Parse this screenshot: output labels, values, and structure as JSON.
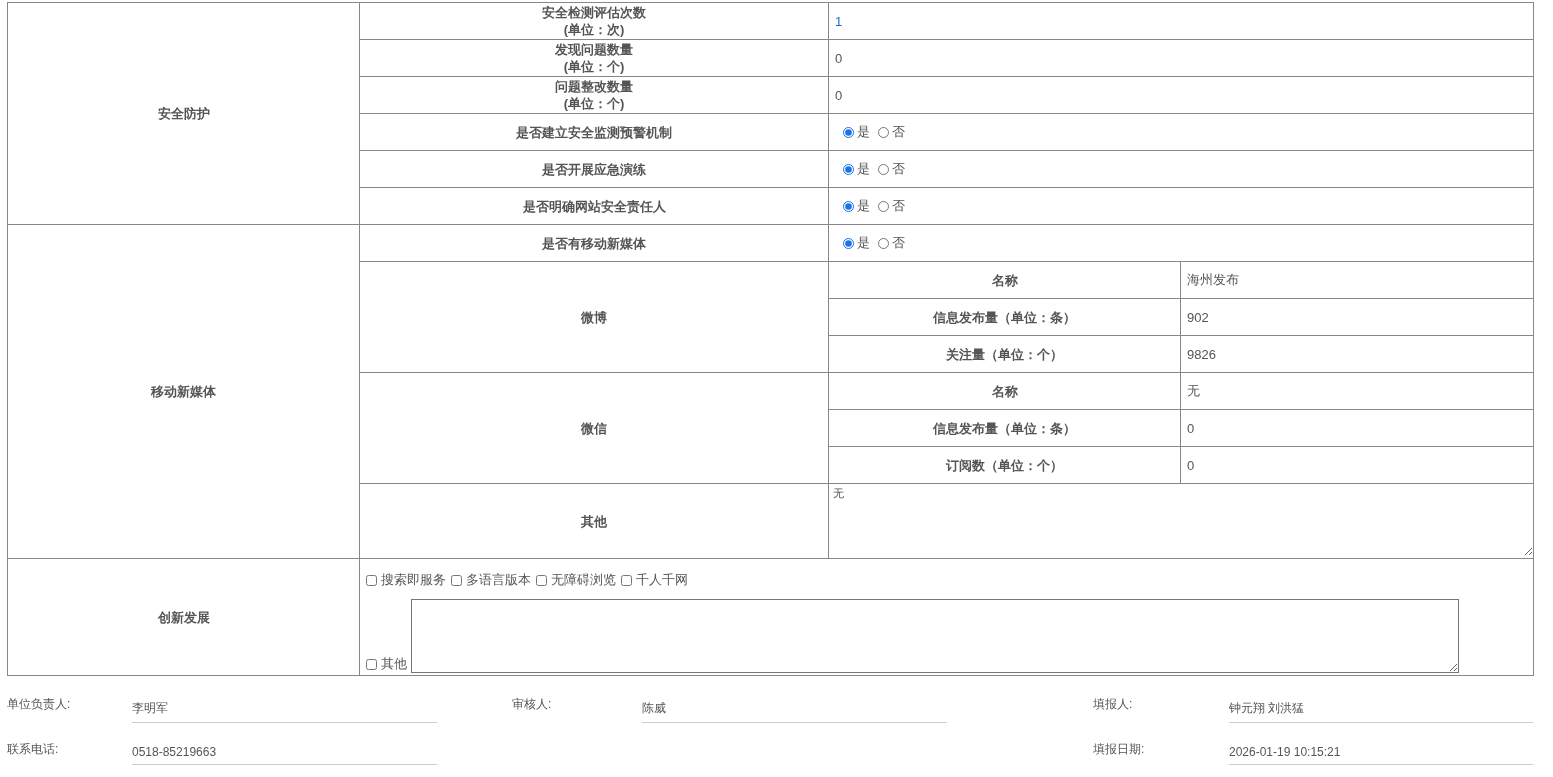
{
  "sections": [
    {
      "title": "安全防护",
      "rows": [
        {
          "kind": "link",
          "label": "安全检测评估次数",
          "label_line2": "(单位：次)",
          "value": "1"
        },
        {
          "kind": "value",
          "label": "发现问题数量",
          "label_line2": "(单位：个)",
          "value": "0"
        },
        {
          "kind": "value",
          "label": "问题整改数量",
          "label_line2": "(单位：个)",
          "value": "0"
        },
        {
          "kind": "radio",
          "label": "是否建立安全监测预警机制",
          "options": [
            {
              "label": "是",
              "selected": true
            },
            {
              "label": "否",
              "selected": false
            }
          ]
        },
        {
          "kind": "radio",
          "label": "是否开展应急演练",
          "options": [
            {
              "label": "是",
              "selected": true
            },
            {
              "label": "否",
              "selected": false
            }
          ]
        },
        {
          "kind": "radio",
          "label": "是否明确网站安全责任人",
          "options": [
            {
              "label": "是",
              "selected": true
            },
            {
              "label": "否",
              "selected": false
            }
          ]
        }
      ]
    },
    {
      "title": "移动新媒体",
      "rows": [
        {
          "kind": "radio",
          "label": "是否有移动新媒体",
          "options": [
            {
              "label": "是",
              "selected": true
            },
            {
              "label": "否",
              "selected": false
            }
          ]
        },
        {
          "kind": "group",
          "label": "微博",
          "fields": [
            {
              "label": "名称",
              "value": "海州发布"
            },
            {
              "label": "信息发布量（单位：条）",
              "value": "902"
            },
            {
              "label": "关注量（单位：个）",
              "value": "9826"
            }
          ]
        },
        {
          "kind": "group",
          "label": "微信",
          "fields": [
            {
              "label": "名称",
              "value": "无"
            },
            {
              "label": "信息发布量（单位：条）",
              "value": "0"
            },
            {
              "label": "订阅数（单位：个）",
              "value": "0"
            }
          ]
        },
        {
          "kind": "textarea",
          "label": "其他",
          "value": "无"
        }
      ]
    },
    {
      "title": "创新发展",
      "rows": [
        {
          "kind": "checklist",
          "options": [
            {
              "label": "搜索即服务",
              "checked": false
            },
            {
              "label": "多语言版本",
              "checked": false
            },
            {
              "label": "无障碍浏览",
              "checked": false
            },
            {
              "label": "千人千网",
              "checked": false
            }
          ],
          "other": {
            "label": "其他",
            "checked": false
          }
        }
      ]
    }
  ],
  "footer": [
    {
      "left": {
        "label": "单位负责人:",
        "value": "李明军"
      },
      "center": {
        "label": "审核人:",
        "value": "陈威"
      },
      "right": {
        "label": "填报人:",
        "value": "钟元翔  刘洪猛"
      }
    },
    {
      "left": {
        "label": "联系电话:",
        "value": "0518-85219663"
      },
      "right": {
        "label": "填报日期:",
        "value": "2026-01-19 10:15:21"
      }
    }
  ]
}
